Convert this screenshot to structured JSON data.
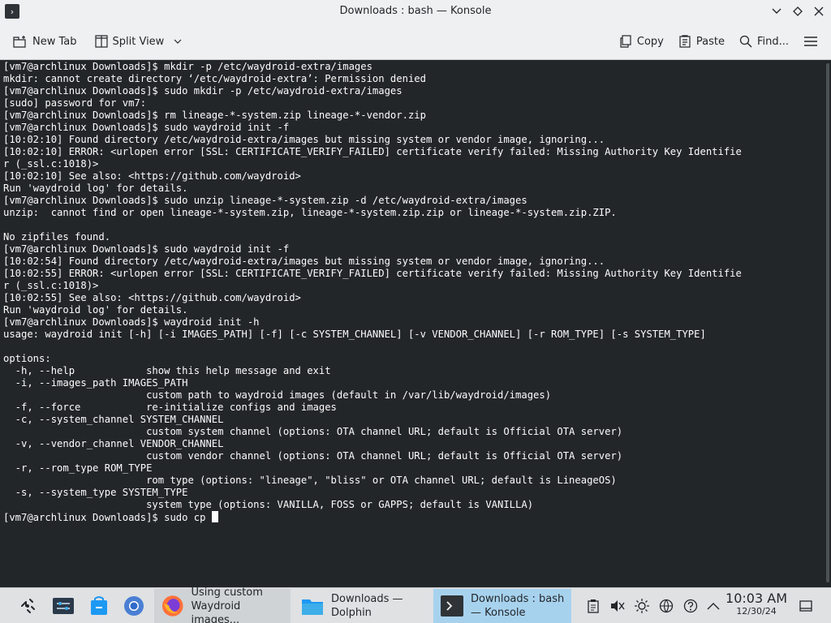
{
  "window": {
    "title": "Downloads : bash — Konsole"
  },
  "toolbar": {
    "new_tab": "New Tab",
    "split_view": "Split View",
    "copy": "Copy",
    "paste": "Paste",
    "find": "Find..."
  },
  "terminal": {
    "lines": [
      "[vm7@archlinux Downloads]$ mkdir -p /etc/waydroid-extra/images",
      "mkdir: cannot create directory ‘/etc/waydroid-extra’: Permission denied",
      "[vm7@archlinux Downloads]$ sudo mkdir -p /etc/waydroid-extra/images",
      "[sudo] password for vm7:",
      "[vm7@archlinux Downloads]$ rm lineage-*-system.zip lineage-*-vendor.zip",
      "[vm7@archlinux Downloads]$ sudo waydroid init -f",
      "[10:02:10] Found directory /etc/waydroid-extra/images but missing system or vendor image, ignoring...",
      "[10:02:10] ERROR: <urlopen error [SSL: CERTIFICATE_VERIFY_FAILED] certificate verify failed: Missing Authority Key Identifie",
      "r (_ssl.c:1018)>",
      "[10:02:10] See also: <https://github.com/waydroid>",
      "Run 'waydroid log' for details.",
      "[vm7@archlinux Downloads]$ sudo unzip lineage-*-system.zip -d /etc/waydroid-extra/images",
      "unzip:  cannot find or open lineage-*-system.zip, lineage-*-system.zip.zip or lineage-*-system.zip.ZIP.",
      "",
      "No zipfiles found.",
      "[vm7@archlinux Downloads]$ sudo waydroid init -f",
      "[10:02:54] Found directory /etc/waydroid-extra/images but missing system or vendor image, ignoring...",
      "[10:02:55] ERROR: <urlopen error [SSL: CERTIFICATE_VERIFY_FAILED] certificate verify failed: Missing Authority Key Identifie",
      "r (_ssl.c:1018)>",
      "[10:02:55] See also: <https://github.com/waydroid>",
      "Run 'waydroid log' for details.",
      "[vm7@archlinux Downloads]$ waydroid init -h",
      "usage: waydroid init [-h] [-i IMAGES_PATH] [-f] [-c SYSTEM_CHANNEL] [-v VENDOR_CHANNEL] [-r ROM_TYPE] [-s SYSTEM_TYPE]",
      "",
      "options:",
      "  -h, --help            show this help message and exit",
      "  -i, --images_path IMAGES_PATH",
      "                        custom path to waydroid images (default in /var/lib/waydroid/images)",
      "  -f, --force           re-initialize configs and images",
      "  -c, --system_channel SYSTEM_CHANNEL",
      "                        custom system channel (options: OTA channel URL; default is Official OTA server)",
      "  -v, --vendor_channel VENDOR_CHANNEL",
      "                        custom vendor channel (options: OTA channel URL; default is Official OTA server)",
      "  -r, --rom_type ROM_TYPE",
      "                        rom type (options: \"lineage\", \"bliss\" or OTA channel URL; default is LineageOS)",
      "  -s, --system_type SYSTEM_TYPE",
      "                        system type (options: VANILLA, FOSS or GAPPS; default is VANILLA)"
    ],
    "prompt_line": "[vm7@archlinux Downloads]$ sudo cp "
  },
  "taskbar": {
    "tasks": [
      {
        "label_line1": "Using custom",
        "label_line2": "Waydroid images..."
      },
      {
        "label_line1": "Downloads —",
        "label_line2": "Dolphin"
      },
      {
        "label_line1": "Downloads : bash",
        "label_line2": "— Konsole"
      }
    ],
    "clock": {
      "time": "10:03 AM",
      "date": "12/30/24"
    }
  },
  "colors": {
    "terminal_bg": "#232629",
    "terminal_fg": "#fcfcfc",
    "active_task": "#a7d2ee",
    "chrome_bg": "#eff0f1"
  }
}
